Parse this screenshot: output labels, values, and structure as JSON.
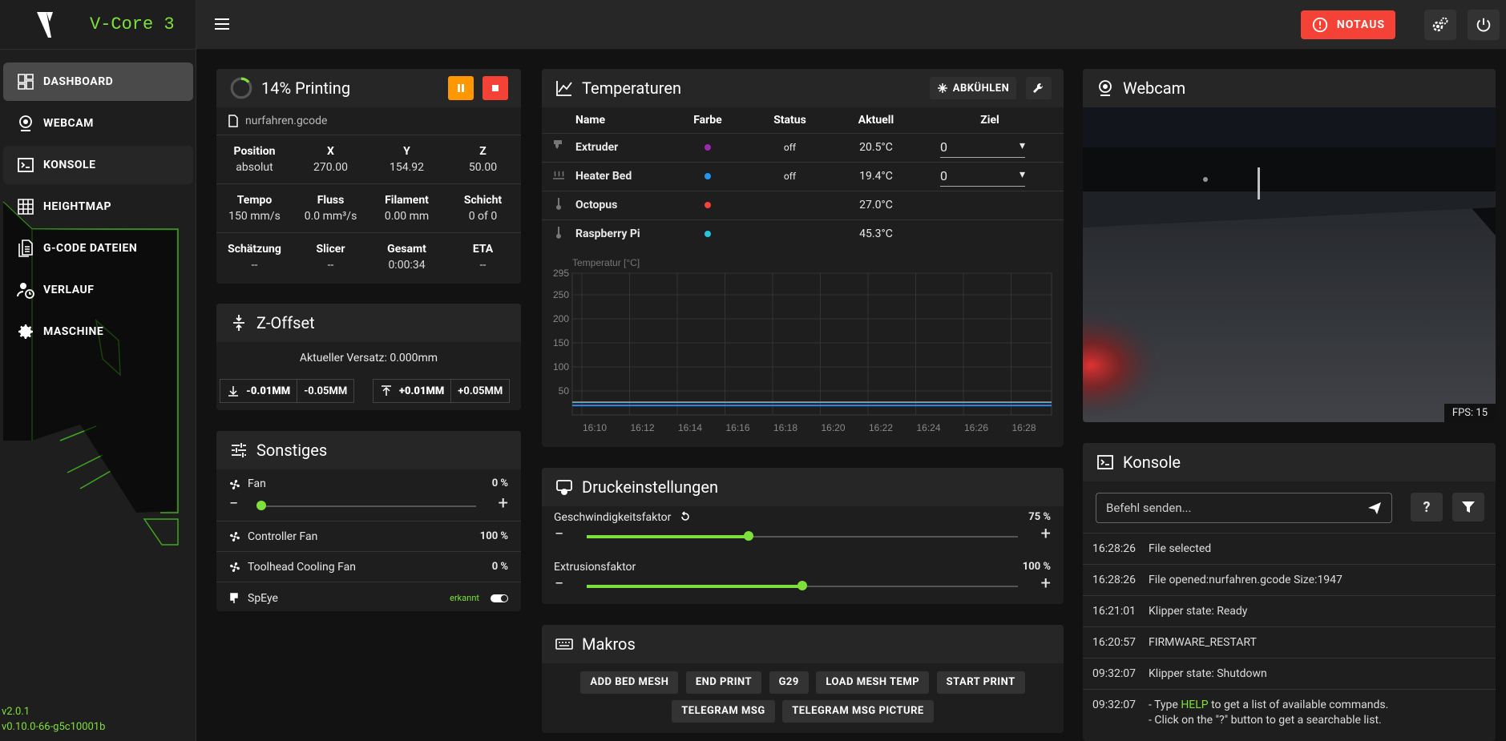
{
  "app": {
    "title": "V-Core 3",
    "version": "v2.0.1",
    "klipper_version": "v0.10.0-66-g5c10001b"
  },
  "nav": [
    {
      "label": "DASHBOARD",
      "icon": "dashboard-icon"
    },
    {
      "label": "WEBCAM",
      "icon": "webcam-icon"
    },
    {
      "label": "KONSOLE",
      "icon": "console-icon"
    },
    {
      "label": "HEIGHTMAP",
      "icon": "grid-icon"
    },
    {
      "label": "G-CODE DATEIEN",
      "icon": "files-icon"
    },
    {
      "label": "VERLAUF",
      "icon": "history-icon"
    },
    {
      "label": "MASCHINE",
      "icon": "gear-icon"
    }
  ],
  "topbar": {
    "notaus_label": "NOTAUS"
  },
  "status": {
    "title": "14% Printing",
    "progress": 0.14,
    "filename": "nurfahren.gcode",
    "position": {
      "label": "Position",
      "mode": "absolut"
    },
    "x": {
      "label": "X",
      "value": "270.00"
    },
    "y": {
      "label": "Y",
      "value": "154.92"
    },
    "z": {
      "label": "Z",
      "value": "50.00"
    },
    "tempo": {
      "label": "Tempo",
      "value": "150 mm/s"
    },
    "fluss": {
      "label": "Fluss",
      "value": "0.0 mm³/s"
    },
    "filament": {
      "label": "Filament",
      "value": "0.00 mm"
    },
    "schicht": {
      "label": "Schicht",
      "value": "0 of 0"
    },
    "schaetzung": {
      "label": "Schätzung",
      "value": "--"
    },
    "slicer": {
      "label": "Slicer",
      "value": "--"
    },
    "gesamt": {
      "label": "Gesamt",
      "value": "0:00:34"
    },
    "eta": {
      "label": "ETA",
      "value": "--"
    }
  },
  "zoffset": {
    "title": "Z-Offset",
    "current": "Aktueller Versatz: 0.000mm",
    "down_small": "-0.01MM",
    "down_big": "-0.05MM",
    "up_small": "+0.01MM",
    "up_big": "+0.05MM"
  },
  "misc": {
    "title": "Sonstiges",
    "fan_label": "Fan",
    "fan_value": "0 %",
    "fan_level": 0,
    "controller_fan_label": "Controller Fan",
    "controller_fan_value": "100 %",
    "toolhead_fan_label": "Toolhead Cooling Fan",
    "toolhead_fan_value": "0 %",
    "speye_label": "SpEye",
    "speye_state": "erkannt"
  },
  "temps": {
    "title": "Temperaturen",
    "cooldown_label": "ABKÜHLEN",
    "headers": {
      "name": "Name",
      "color": "Farbe",
      "status": "Status",
      "current": "Aktuell",
      "target": "Ziel"
    },
    "rows": [
      {
        "name": "Extruder",
        "color": "#9c27b0",
        "status": "off",
        "current": "20.5°C",
        "target": "0"
      },
      {
        "name": "Heater Bed",
        "color": "#2196f3",
        "status": "off",
        "current": "19.4°C",
        "target": "0"
      },
      {
        "name": "Octopus",
        "color": "#f44336",
        "status": "",
        "current": "27.0°C",
        "target": ""
      },
      {
        "name": "Raspberry Pi",
        "color": "#26c6da",
        "status": "",
        "current": "45.3°C",
        "target": ""
      }
    ]
  },
  "chart_data": {
    "type": "line",
    "ylabel": "Temperatur [°C]",
    "ylim": [
      0,
      295
    ],
    "yticks": [
      295,
      250,
      200,
      150,
      100,
      50
    ],
    "x": [
      "16:10",
      "16:12",
      "16:14",
      "16:16",
      "16:18",
      "16:20",
      "16:22",
      "16:24",
      "16:26",
      "16:28"
    ],
    "series": [
      {
        "color": "#9c27b0",
        "values": [
          20.5,
          20.5,
          20.5,
          20.5,
          20.5,
          20.5,
          20.5,
          20.5,
          20.5,
          20.5
        ]
      },
      {
        "color": "#2196f3",
        "values": [
          19.4,
          19.4,
          19.4,
          19.4,
          19.4,
          19.4,
          19.4,
          19.4,
          19.4,
          19.4
        ]
      },
      {
        "color": "#f44336",
        "values": [
          27,
          27,
          27,
          27,
          27,
          27,
          27,
          27,
          27,
          27
        ]
      },
      {
        "color": "#26c6da",
        "values": [
          26,
          26,
          26,
          26,
          26,
          26,
          26,
          26,
          26,
          26
        ]
      }
    ]
  },
  "print_settings": {
    "title": "Druckeinstellungen",
    "speed_label": "Geschwindigkeitsfaktor",
    "speed_value": "75 %",
    "speed_level": 0.375,
    "extrusion_label": "Extrusionsfaktor",
    "extrusion_value": "100 %",
    "extrusion_level": 0.5
  },
  "macros": {
    "title": "Makros",
    "row1": [
      "ADD BED MESH",
      "END PRINT",
      "G29",
      "LOAD MESH TEMP",
      "START PRINT"
    ],
    "row2": [
      "TELEGRAM MSG",
      "TELEGRAM MSG PICTURE"
    ]
  },
  "webcam": {
    "title": "Webcam",
    "fps": "FPS: 15"
  },
  "console": {
    "title": "Konsole",
    "placeholder": "Befehl senden...",
    "lines": [
      {
        "time": "16:28:26",
        "msg": "File selected"
      },
      {
        "time": "16:28:26",
        "msg": "File opened:nurfahren.gcode Size:1947"
      },
      {
        "time": "16:21:01",
        "msg": "Klipper state: Ready"
      },
      {
        "time": "16:20:57",
        "msg": "FIRMWARE_RESTART"
      },
      {
        "time": "09:32:07",
        "msg": "Klipper state: Shutdown"
      },
      {
        "time": "09:32:07",
        "msg_a": "- Type ",
        "msg_help": "HELP",
        "msg_b": " to get a list of available commands.",
        "msg2": "- Click on the \"?\" button to get a searchable list."
      }
    ]
  }
}
